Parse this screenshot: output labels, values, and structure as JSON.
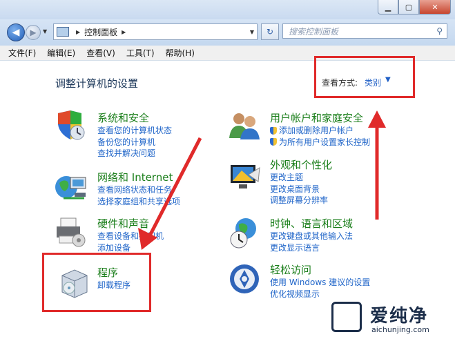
{
  "window": {
    "min": "▁",
    "max": "▢",
    "close": "✕"
  },
  "address": {
    "path": "控制面板",
    "back": "◀",
    "forward": "▶",
    "refresh": "↻"
  },
  "search": {
    "placeholder": "搜索控制面板"
  },
  "menu": [
    "文件(F)",
    "编辑(E)",
    "查看(V)",
    "工具(T)",
    "帮助(H)"
  ],
  "heading": "调整计算机的设置",
  "view_by": {
    "label": "查看方式:",
    "value": "类别"
  },
  "categories": {
    "security": {
      "title": "系统和安全",
      "links": [
        "查看您的计算机状态",
        "备份您的计算机",
        "查找并解决问题"
      ]
    },
    "network": {
      "title": "网络和 Internet",
      "links": [
        "查看网络状态和任务",
        "选择家庭组和共享选项"
      ]
    },
    "hardware": {
      "title": "硬件和声音",
      "links": [
        "查看设备和打印机",
        "添加设备"
      ]
    },
    "programs": {
      "title": "程序",
      "links": [
        "卸载程序"
      ]
    },
    "users": {
      "title": "用户帐户和家庭安全",
      "links": [
        "添加或删除用户帐户",
        "为所有用户设置家长控制"
      ]
    },
    "appearance": {
      "title": "外观和个性化",
      "links": [
        "更改主题",
        "更改桌面背景",
        "调整屏幕分辨率"
      ]
    },
    "clock": {
      "title": "时钟、语言和区域",
      "links": [
        "更改键盘或其他输入法",
        "更改显示语言"
      ]
    },
    "access": {
      "title": "轻松访问",
      "links": [
        "使用 Windows 建议的设置",
        "优化视频显示"
      ]
    }
  },
  "watermark": {
    "cn": "爱纯净",
    "en": "aichunjing.com"
  },
  "colors": {
    "category_title": "#1a7e1a",
    "link": "#2166c9",
    "annotation": "#e02a2a"
  }
}
